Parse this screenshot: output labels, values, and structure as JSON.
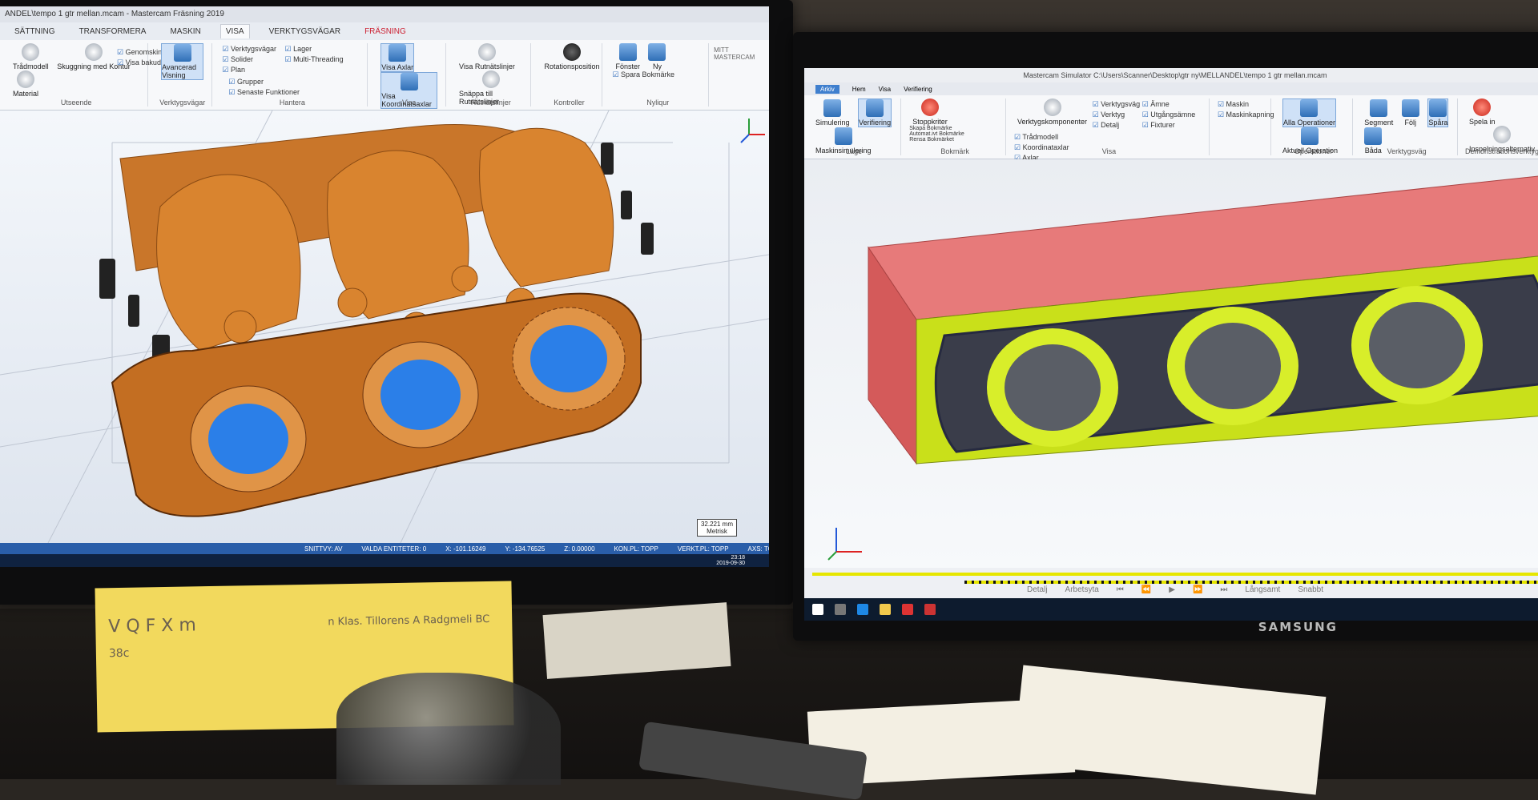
{
  "left_app": {
    "title": "ANDEL\\tempo 1 gtr mellan.mcam - Mastercam Fräsning 2019",
    "tabs": [
      "SÄTTNING",
      "TRANSFORMERA",
      "MASKIN",
      "VISA",
      "VERKTYGSVÄGAR"
    ],
    "active_tab": "VISA",
    "context_tab": "FRÄSNING",
    "ribbon": {
      "appearance_buttons": [
        "Trådmodell",
        "Skuggning med Kontur",
        "Material"
      ],
      "appearance_checks": [
        "Genomskinlig",
        "Visa bakuda"
      ],
      "appearance_group": "Utseende",
      "advanced_view": "Avancerad Visning",
      "toolpaths_group": "Verktygsvägar",
      "manage_checks": [
        "Verktygsvägar",
        "Solider",
        "Plan",
        "Lager",
        "Multi-Threading"
      ],
      "manage_checks2": [
        "Grupper",
        "Senaste Funktioner"
      ],
      "manage_group": "Hantera",
      "view_buttons": [
        "Visa Axlar",
        "Visa Koordinatsaxlar"
      ],
      "view_group": "Visa",
      "rotation_buttons": [
        "Visa Rutnätslinjer",
        "Snäppa till Rutnätslinjer"
      ],
      "rotation_group": "Rutnätslinjer",
      "controller_button": "Rotationsposition",
      "controller_group": "Kontroller",
      "notes_buttons": [
        "Fönster",
        "Ny"
      ],
      "notes_group": "Nyliqur",
      "notes_items": [
        "Spara Bokmärke"
      ],
      "right_label": "MITT MASTERCAM"
    },
    "status": {
      "snitt": "SNITTVY: AV",
      "valda": "VALDA ENTITETER: 0",
      "x": "X: -101.16249",
      "y": "Y: -134.76525",
      "z": "Z: 0.00000",
      "konpl": "KON.PL: TOPP",
      "verktpl": "VERKT.PL: TOPP",
      "axes": "AXS: TOPP"
    },
    "scale_value": "32.221 mm",
    "scale_unit": "Metrisk",
    "clock": "23:18",
    "date": "2019-09-30"
  },
  "right_app": {
    "title": "Mastercam Simulator C:\\Users\\Scanner\\Desktop\\gtr ny\\MELLANDEL\\tempo 1 gtr mellan.mcam",
    "tabs": [
      "Arkiv",
      "Hem",
      "Visa",
      "Verifiering"
    ],
    "active_tab": "Arkiv",
    "ribbon": {
      "sim_buttons": [
        "Simulering",
        "Verifiering",
        "Maskinsimulering"
      ],
      "mode_group": "Läge",
      "stop_button": "Stoppkriter",
      "bookmarks": [
        "Skapa Bokmärke",
        "Automat.ivt Bokmärke",
        "Rensa Bokmärket"
      ],
      "bookmarks_group": "Bokmärk",
      "tool_components": "Verktygskomponenter",
      "vis_checks_1": [
        "Verktygsväg",
        "Verktyg",
        "Detalj"
      ],
      "vis_checks_2": [
        "Ämne",
        "Utgångsämne",
        "Fixturer"
      ],
      "vis_checks_3": [
        "Trådmodell",
        "Koordinataxlar",
        "Axlar"
      ],
      "vis_checks_4": [
        "Maskin",
        "Maskinkapning"
      ],
      "vis_group": "Visa",
      "op_buttons": [
        "Alla Operationer",
        "Aktuell Operation"
      ],
      "op_group": "Operationer",
      "path_buttons": [
        "Segment",
        "Följ",
        "Spåra",
        "Båda"
      ],
      "path_group": "Verktygsväg",
      "demo_buttons": [
        "Spela in",
        "Inspelningsalternativ"
      ],
      "demo_group": "Demonstrationsverktyg"
    },
    "play_labels": [
      "Detalj",
      "Arbetsyta",
      "Långsamt",
      "Snabbt"
    ],
    "brand": "SAMSUNG"
  },
  "desk_note": {
    "line1": "V Q F X m",
    "line2": "38c",
    "line3": "n Klas. Tillorens A Radgmeli BC"
  },
  "colors": {
    "part_orange": "#d9842f",
    "bore_blue": "#2b7fe8",
    "stock_red": "#e06464",
    "cut_yellow": "#c9e01a",
    "ribbon_blue": "#2a5ea9"
  }
}
